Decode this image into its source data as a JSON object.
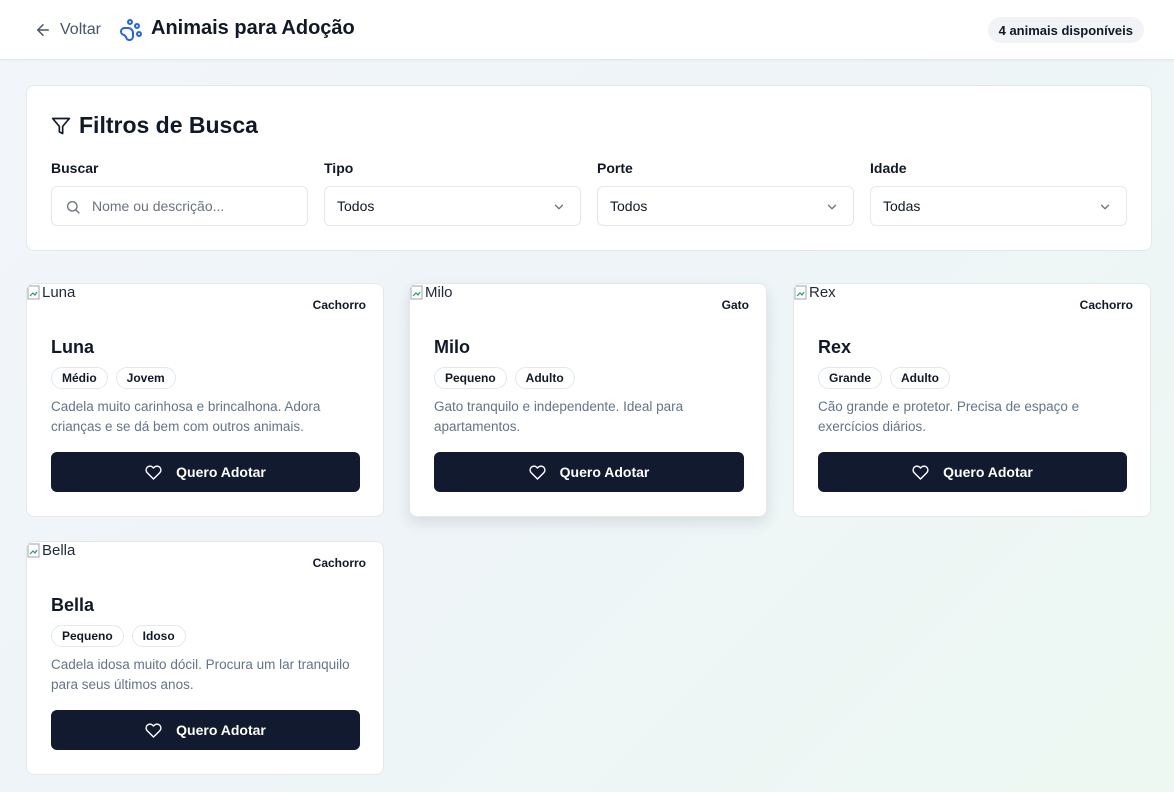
{
  "header": {
    "back_label": "Voltar",
    "title": "Animais para Adoção",
    "count_badge": "4 animais disponíveis"
  },
  "filters": {
    "title": "Filtros de Busca",
    "search": {
      "label": "Buscar",
      "placeholder": "Nome ou descrição..."
    },
    "tipo": {
      "label": "Tipo",
      "value": "Todos"
    },
    "porte": {
      "label": "Porte",
      "value": "Todos"
    },
    "idade": {
      "label": "Idade",
      "value": "Todas"
    }
  },
  "animals": [
    {
      "image_alt": "Luna",
      "type": "Cachorro",
      "name": "Luna",
      "size": "Médio",
      "age": "Jovem",
      "description": "Cadela muito carinhosa e brincalhona. Adora crianças e se dá bem com outros animais.",
      "button": "Quero Adotar"
    },
    {
      "image_alt": "Milo",
      "type": "Gato",
      "name": "Milo",
      "size": "Pequeno",
      "age": "Adulto",
      "description": "Gato tranquilo e independente. Ideal para apartamentos.",
      "button": "Quero Adotar"
    },
    {
      "image_alt": "Rex",
      "type": "Cachorro",
      "name": "Rex",
      "size": "Grande",
      "age": "Adulto",
      "description": "Cão grande e protetor. Precisa de espaço e exercícios diários.",
      "button": "Quero Adotar"
    },
    {
      "image_alt": "Bella",
      "type": "Cachorro",
      "name": "Bella",
      "size": "Pequeno",
      "age": "Idoso",
      "description": "Cadela idosa muito dócil. Procura um lar tranquilo para seus últimos anos.",
      "button": "Quero Adotar"
    }
  ],
  "icons": {
    "back": "arrow-left-icon",
    "brand": "paw-print-icon",
    "filter": "filter-funnel-icon",
    "search": "search-icon",
    "dropdown": "chevron-down-icon",
    "broken_image": "broken-image-icon",
    "adopt": "heart-icon"
  },
  "colors": {
    "brand_icon": "#2563eb",
    "primary_button": "#111a2e",
    "muted_text": "#64748b"
  }
}
